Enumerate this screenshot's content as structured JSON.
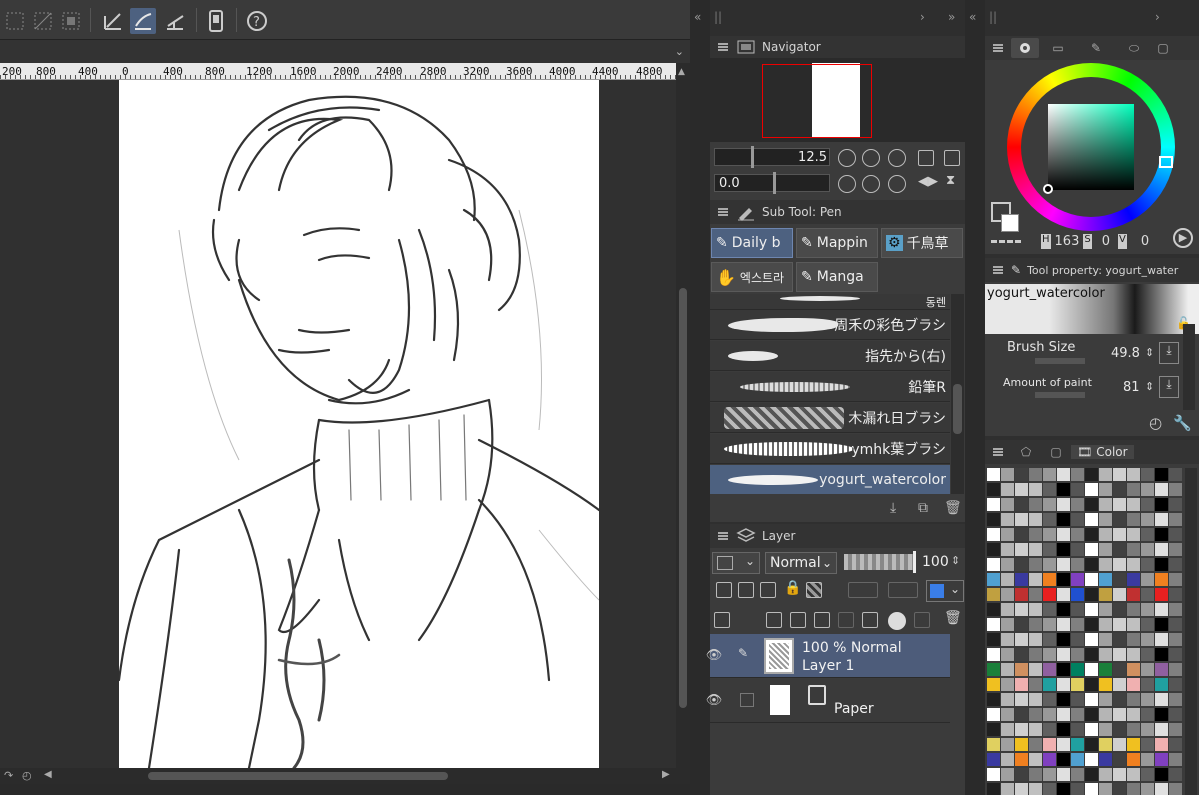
{
  "navigator": {
    "title": "Navigator",
    "zoom": "12.5",
    "rotation": "0.0"
  },
  "ruler": {
    "ticks": [
      "200",
      "800",
      "400",
      "0",
      "400",
      "800",
      "1200",
      "1600",
      "2000",
      "2400",
      "2800",
      "3200",
      "3600",
      "4000",
      "4400",
      "4800"
    ]
  },
  "sub_tool": {
    "title": "Sub Tool: Pen",
    "tabs": [
      "Daily b",
      "Mappin",
      "千鳥草",
      "엑스트라",
      "Manga"
    ],
    "brushes": [
      "동렌",
      "周禾の彩色ブラシ",
      "指先から(右)",
      "鉛筆R",
      "木漏れ日ブラシ",
      "ymhk葉ブラシ",
      "yogurt_watercolor"
    ],
    "selected_brush": "yogurt_watercolor"
  },
  "layer": {
    "title": "Layer",
    "blend_mode": "Normal",
    "opacity": "100",
    "layers": [
      {
        "line1": "100 % Normal",
        "line2": "Layer 1",
        "active": true
      },
      {
        "line1": "",
        "line2": "Paper",
        "active": false
      }
    ]
  },
  "color_wheel": {
    "hsv": {
      "h_label": "H",
      "h": "163",
      "s_label": "S",
      "s": "0",
      "v_label": "V",
      "v": "0"
    },
    "main_color": "#0e1a2e",
    "ring_marker_color": "#4fe0c0"
  },
  "tool_property": {
    "title": "Tool property: yogurt_water",
    "brush_name": "yogurt_watercolor",
    "brush_size_label": "Brush Size",
    "brush_size": "49.8",
    "amount_label": "Amount of paint",
    "amount": "81"
  },
  "color_set": {
    "tab_label": "Color"
  }
}
